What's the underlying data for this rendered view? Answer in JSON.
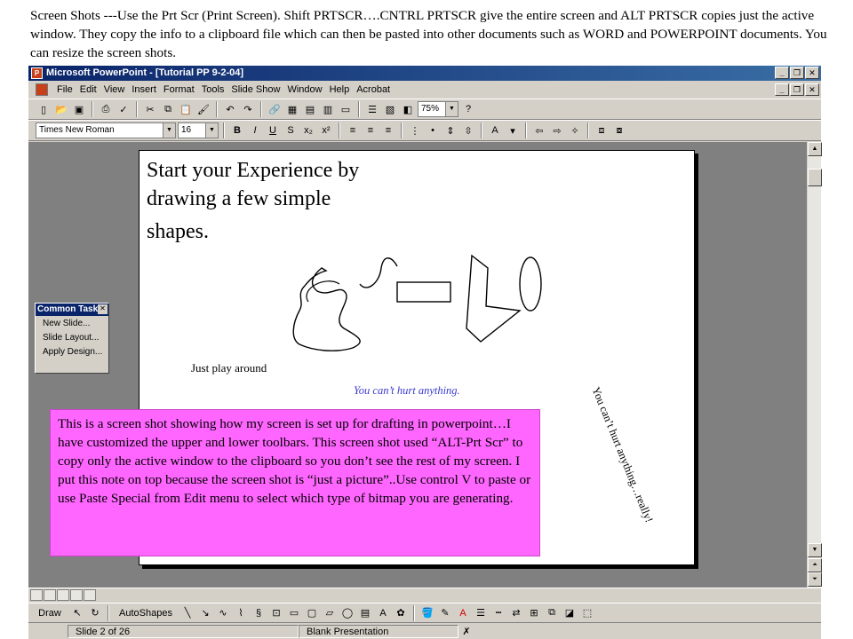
{
  "caption": "Screen Shots ---Use the Prt Scr (Print Screen).  Shift PRTSCR….CNTRL PRTSCR give the entire screen and ALT PRTSCR copies just the active window.  They copy the info to a clipboard file which can then be pasted into other documents such as WORD and POWERPOINT documents.  You can resize the screen shots.",
  "window": {
    "title": "Microsoft PowerPoint - [Tutorial PP 9-2-04]"
  },
  "menu": [
    "File",
    "Edit",
    "View",
    "Insert",
    "Format",
    "Tools",
    "Slide Show",
    "Window",
    "Help",
    "Acrobat"
  ],
  "toolbar": {
    "zoom": "75%",
    "font": "Times New Roman",
    "size": "16",
    "bold": "B",
    "italic": "I",
    "underline": "U",
    "shadow": "S"
  },
  "slide": {
    "title_line1": "Start your Experience by",
    "title_line2": "drawing a few simple",
    "title_line3": "shapes.",
    "play": "Just play around",
    "hurt": "You can’t hurt anything.",
    "rotated": "You can’t hurt anything…really!"
  },
  "common_tasks": {
    "title": "Common Tasks",
    "items": [
      "New Slide...",
      "Slide Layout...",
      "Apply Design..."
    ]
  },
  "drawbar": {
    "draw": "Draw",
    "autoshapes": "AutoShapes"
  },
  "status": {
    "slide": "Slide 2 of 26",
    "design": "Blank Presentation"
  },
  "note": "This is a screen shot showing how my screen is set up for drafting in powerpoint…I have customized the upper and lower toolbars.  This screen shot used “ALT-Prt Scr” to copy only the active window  to the clipboard so you don’t see the rest of my screen.  I put this note on top because the screen shot is “just a picture”..Use control V to paste or use Paste Special from Edit menu to select which type of bitmap you are generating."
}
